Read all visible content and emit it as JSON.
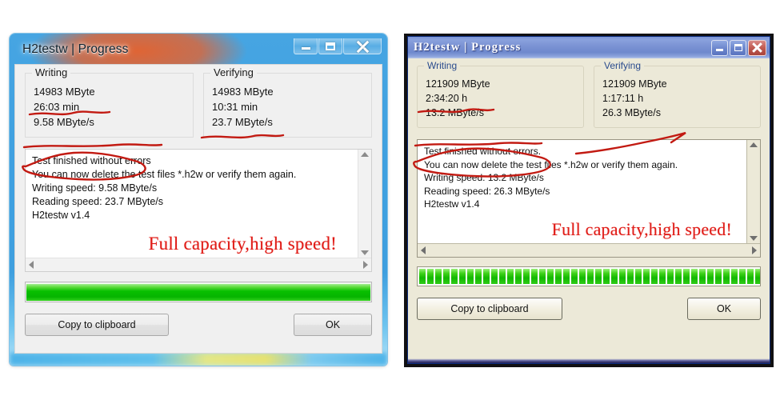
{
  "windows": [
    {
      "id": "win7",
      "style": "aero",
      "title": "H2testw | Progress",
      "controls": {
        "minimize": "minimize-icon",
        "maximize": "maximize-icon",
        "close": "close-icon"
      },
      "panels": [
        {
          "legend": "Writing",
          "metrics": [
            "14983 MByte",
            "26:03 min",
            "9.58 MByte/s"
          ]
        },
        {
          "legend": "Verifying",
          "metrics": [
            "14983 MByte",
            "10:31 min",
            "23.7 MByte/s"
          ]
        }
      ],
      "output": {
        "lines": [
          "Test finished without errors",
          "You can now delete the test files *.h2w or verify them again.",
          "Writing speed: 9.58 MByte/s",
          "Reading speed: 23.7 MByte/s",
          "H2testw v1.4"
        ],
        "annotation": "Full capacity,high speed!"
      },
      "progress": {
        "percent": 100,
        "color": "#08c000"
      },
      "buttons": {
        "copy": "Copy to clipboard",
        "ok": "OK"
      }
    },
    {
      "id": "winxp",
      "style": "luna",
      "title": "H2testw | Progress",
      "controls": {
        "minimize": "minimize-icon",
        "maximize": "maximize-icon",
        "close": "close-icon"
      },
      "panels": [
        {
          "legend": "Writing",
          "metrics": [
            "121909 MByte",
            "2:34:20 h",
            "13.2 MByte/s"
          ]
        },
        {
          "legend": "Verifying",
          "metrics": [
            "121909 MByte",
            "1:17:11 h",
            "26.3 MByte/s"
          ]
        }
      ],
      "output": {
        "lines": [
          "Test finished without errors.",
          "You can now delete the test files *.h2w or verify them again.",
          "Writing speed: 13.2 MByte/s",
          "Reading speed: 26.3 MByte/s",
          "H2testw v1.4"
        ],
        "annotation": "Full capacity,high speed!"
      },
      "progress": {
        "percent": 100,
        "segments": 44,
        "color": "#13b800"
      },
      "buttons": {
        "copy": "Copy to clipboard",
        "ok": "OK"
      }
    }
  ],
  "markup_color": "#c21a12"
}
